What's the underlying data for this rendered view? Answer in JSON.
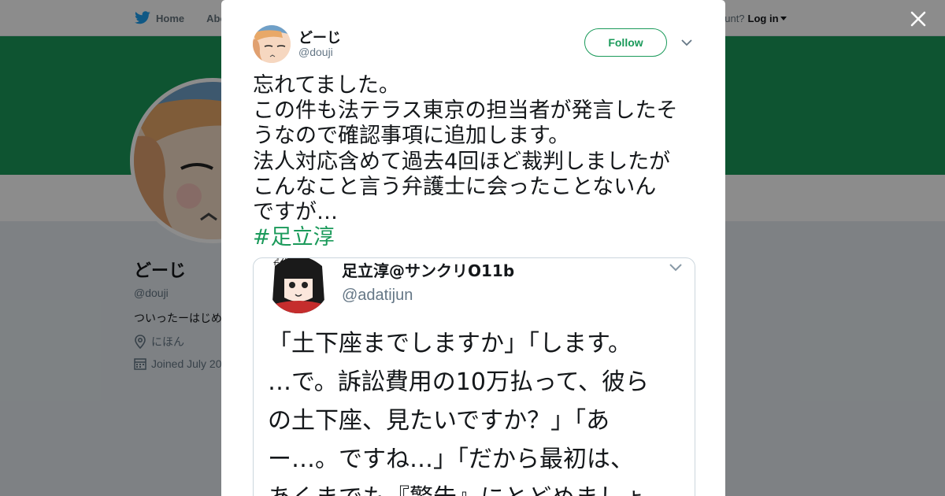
{
  "nav": {
    "home_label": "Home",
    "about_label": "Abo",
    "account_prompt": "ccount?",
    "login_label": "Log in"
  },
  "profile": {
    "name": "どーじ",
    "handle": "@douji",
    "bio": "ついったーはじめ",
    "location": "にほん",
    "joined": "Joined July 20"
  },
  "tweet": {
    "author_name": "どーじ",
    "author_handle": "@douji",
    "follow_label": "Follow",
    "lines": [
      "忘れてました。",
      "この件も法テラス東京の担当者が発言したそ",
      "うなので確認事項に追加します。",
      "法人対応含めて過去4回ほど裁判しましたが",
      "こんなこと言う弁護士に会ったことないん",
      "ですが…"
    ],
    "hashtag": "#足立淳"
  },
  "quoted": {
    "name": "足立淳@サンクリO11b",
    "handle": "@adatijun",
    "avatar_text": "岸花",
    "lines": [
      "「土下座までしますか」「します。",
      "…で。訴訟費用の10万払って、彼ら",
      "の土下座、見たいですか？」「あ",
      "ー…。ですね…」「だから最初は、",
      "あくまでも『警告』にとどめましょ"
    ]
  },
  "colors": {
    "accent": "#1a9a5a",
    "twitter_blue": "#1da1f2",
    "overlay": "rgba(0,0,0,0.45)"
  },
  "icons": {
    "close": "close-icon",
    "location": "location-pin-icon",
    "calendar": "calendar-icon",
    "more": "chevron-down-icon",
    "logo": "twitter-bird-icon"
  }
}
